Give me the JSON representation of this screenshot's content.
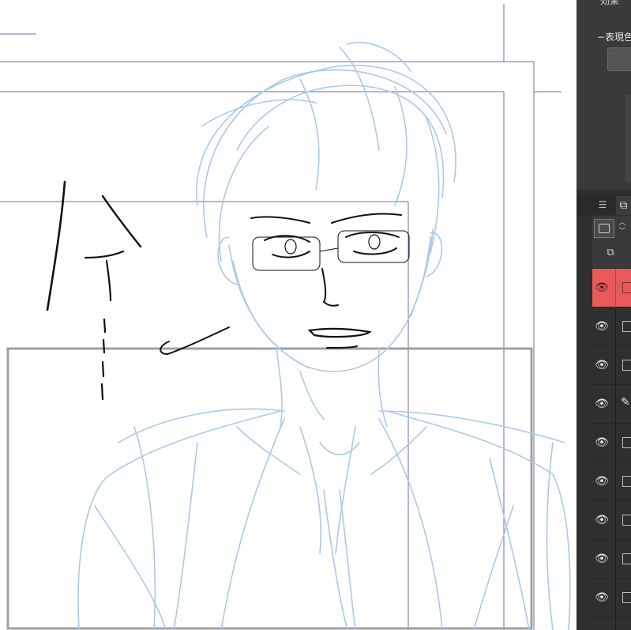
{
  "panel": {
    "top_title": "効果",
    "color_label": "−表現色"
  },
  "tabs": {
    "menu": "☰",
    "layers": "⧉"
  },
  "toolbar": {
    "stepper": "︿\n﹀",
    "copy": "⧉"
  },
  "layers": [
    {
      "eye": "👁",
      "active": true
    },
    {
      "eye": "👁"
    },
    {
      "eye": "👁"
    },
    {
      "eye": "👁",
      "pen": "✎"
    },
    {
      "eye": "👁"
    },
    {
      "eye": "👁"
    },
    {
      "eye": "👁"
    },
    {
      "eye": "👁"
    },
    {
      "eye": "👁"
    },
    {
      "eye": "👁"
    }
  ],
  "colors": {
    "sketch": "#aac8ec",
    "ink": "#111111",
    "guide": "#6b6bb5",
    "frame": "#a0a0a0",
    "active_layer": "#e85a5a"
  }
}
